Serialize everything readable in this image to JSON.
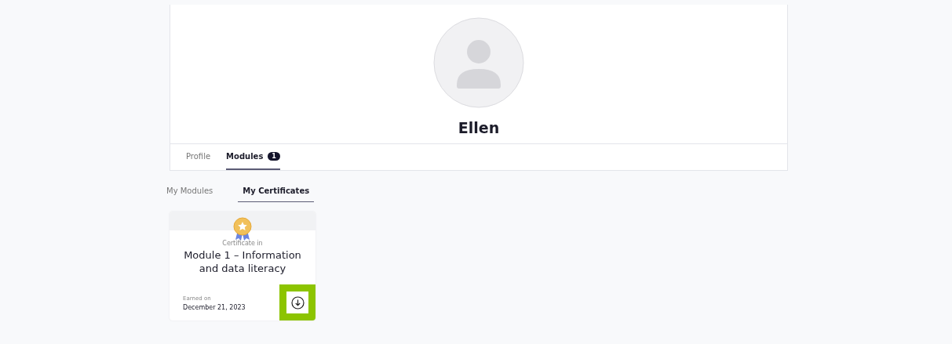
{
  "profile": {
    "name": "Ellen"
  },
  "tabs": [
    {
      "label": "Profile",
      "selected": false
    },
    {
      "label": "Modules",
      "selected": true,
      "badge": "1"
    }
  ],
  "subtabs": [
    {
      "label": "My Modules",
      "selected": false
    },
    {
      "label": "My Certificates",
      "selected": true
    }
  ],
  "certificates": [
    {
      "caption": "Certificate in",
      "title": "Module 1 – Information and data literacy",
      "earned_label": "Earned on",
      "earned_date": "December 21, 2023",
      "download_highlighted": true
    }
  ]
}
